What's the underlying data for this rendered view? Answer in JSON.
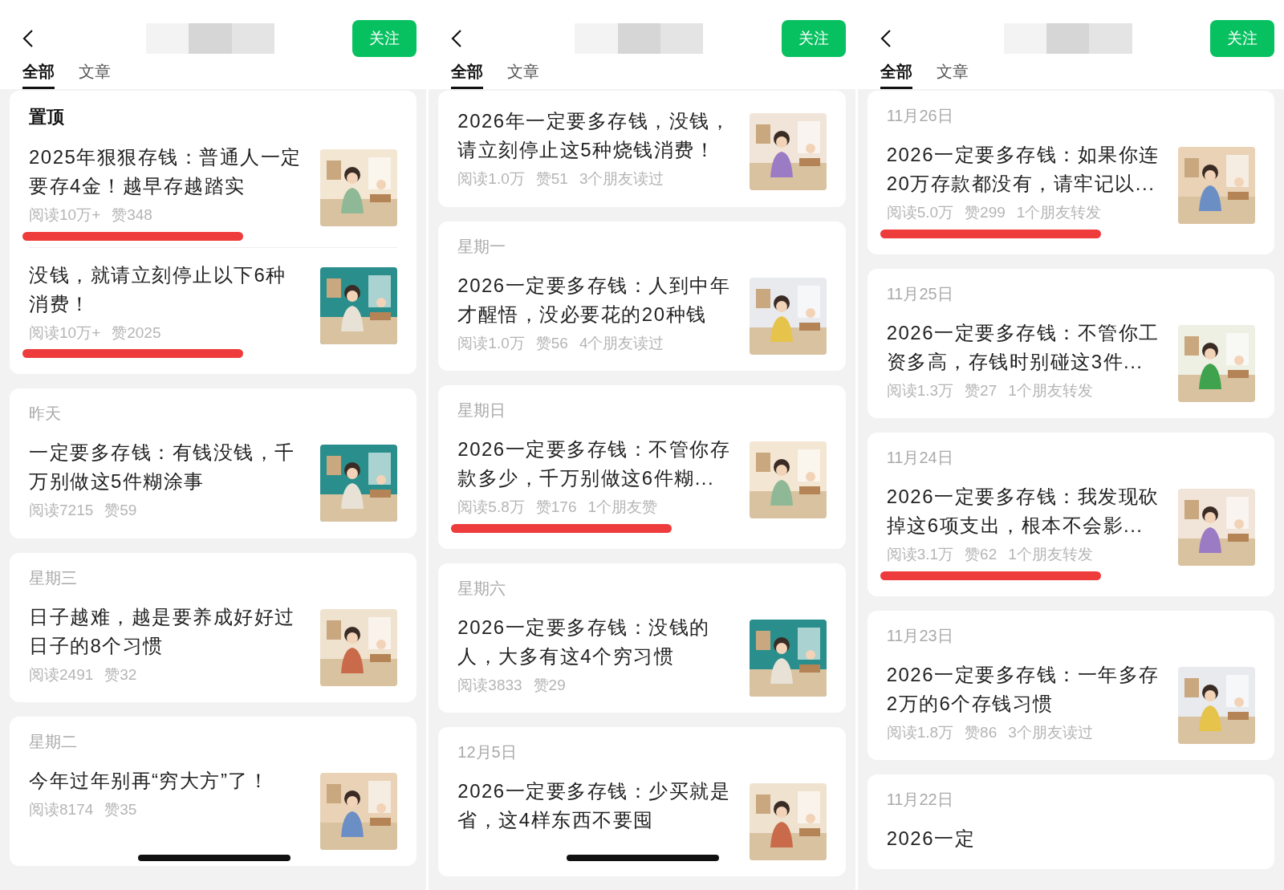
{
  "panels": [
    {
      "follow_button": "关注",
      "tabs": [
        {
          "label": "全部",
          "selected": true
        },
        {
          "label": "文章",
          "selected": false
        }
      ],
      "cards": [
        {
          "label": "置顶",
          "pinned": true,
          "items": [
            {
              "title": "2025年狠狠存钱：普通人一定要存4金！越早存越踏实",
              "stats": [
                "阅读10万+",
                "赞348"
              ],
              "underlined": true
            },
            {
              "title": "没钱，就请立刻停止以下6种消费！",
              "stats": [
                "阅读10万+",
                "赞2025"
              ],
              "underlined": true
            }
          ]
        },
        {
          "label": "昨天",
          "pinned": false,
          "items": [
            {
              "title": "一定要多存钱：有钱没钱，千万别做这5件糊涂事",
              "stats": [
                "阅读7215",
                "赞59"
              ],
              "underlined": false
            }
          ]
        },
        {
          "label": "星期三",
          "pinned": false,
          "items": [
            {
              "title": "日子越难，越是要养成好好过日子的8个习惯",
              "stats": [
                "阅读2491",
                "赞32"
              ],
              "underlined": false
            }
          ]
        },
        {
          "label": "星期二",
          "pinned": false,
          "items": [
            {
              "title": "今年过年别再“穷大方”了！",
              "stats": [
                "阅读8174",
                "赞35"
              ],
              "underlined": false
            }
          ]
        }
      ]
    },
    {
      "follow_button": "关注",
      "tabs": [
        {
          "label": "全部",
          "selected": true
        },
        {
          "label": "文章",
          "selected": false
        }
      ],
      "cards": [
        {
          "items": [
            {
              "title": "2026年一定要多存钱，没钱，请立刻停止这5种烧钱消费！",
              "stats": [
                "阅读1.0万",
                "赞51",
                "3个朋友读过"
              ],
              "underlined": false
            }
          ]
        },
        {
          "label": "星期一",
          "pinned": false,
          "items": [
            {
              "title": "2026一定要多存钱：人到中年才醒悟，没必要花的20种钱",
              "stats": [
                "阅读1.0万",
                "赞56",
                "4个朋友读过"
              ],
              "underlined": false
            }
          ]
        },
        {
          "label": "星期日",
          "pinned": false,
          "items": [
            {
              "title": "2026一定要多存钱：不管你存款多少，千万别做这6件糊...",
              "stats": [
                "阅读5.8万",
                "赞176",
                "1个朋友赞"
              ],
              "underlined": true
            }
          ]
        },
        {
          "label": "星期六",
          "pinned": false,
          "items": [
            {
              "title": "2026一定要多存钱：没钱的人，大多有这4个穷习惯",
              "stats": [
                "阅读3833",
                "赞29"
              ],
              "underlined": false
            }
          ]
        },
        {
          "label": "12月5日",
          "pinned": false,
          "items": [
            {
              "title": "2026一定要多存钱：少买就是省，这4样东西不要囤",
              "underlined": false
            }
          ]
        }
      ]
    },
    {
      "follow_button": "关注",
      "tabs": [
        {
          "label": "全部",
          "selected": true
        },
        {
          "label": "文章",
          "selected": false
        }
      ],
      "cards": [
        {
          "label": "11月26日",
          "pinned": false,
          "items": [
            {
              "title": "2026一定要多存钱：如果你连20万存款都没有，请牢记以...",
              "stats": [
                "阅读5.0万",
                "赞299",
                "1个朋友转发"
              ],
              "underlined": true
            }
          ]
        },
        {
          "label": "11月25日",
          "pinned": false,
          "items": [
            {
              "title": "2026一定要多存钱：不管你工资多高，存钱时别碰这3件...",
              "stats": [
                "阅读1.3万",
                "赞27",
                "1个朋友转发"
              ],
              "underlined": false
            }
          ]
        },
        {
          "label": "11月24日",
          "pinned": false,
          "items": [
            {
              "title": "2026一定要多存钱：我发现砍掉这6项支出，根本不会影...",
              "stats": [
                "阅读3.1万",
                "赞62",
                "1个朋友转发"
              ],
              "underlined": true
            }
          ]
        },
        {
          "label": "11月23日",
          "pinned": false,
          "items": [
            {
              "title": "2026一定要多存钱：一年多存2万的6个存钱习惯",
              "stats": [
                "阅读1.8万",
                "赞86",
                "3个朋友读过"
              ],
              "underlined": false
            }
          ]
        },
        {
          "label": "11月22日",
          "pinned": false,
          "items": [
            {
              "title": "2026一定",
              "underlined": false,
              "has_picture": false
            }
          ]
        }
      ]
    }
  ]
}
